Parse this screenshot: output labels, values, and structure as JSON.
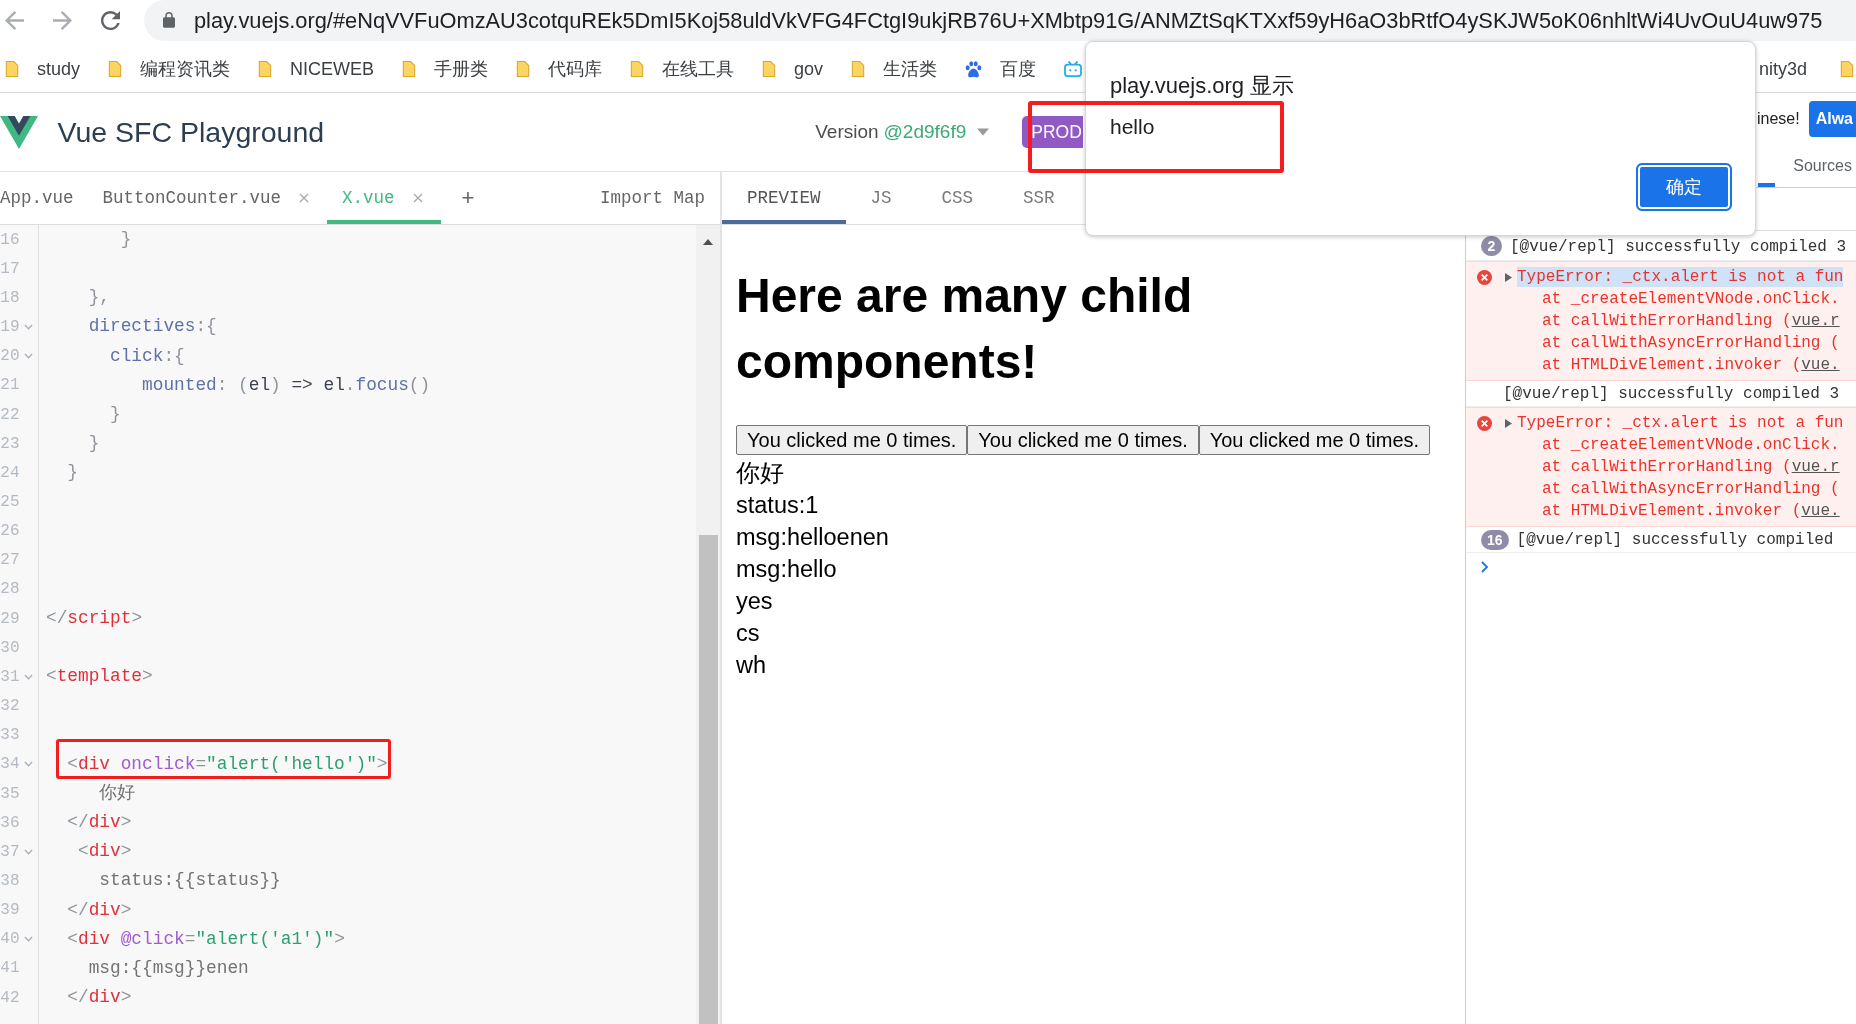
{
  "browser": {
    "nav_buttons": [
      {
        "kind": "back",
        "disabled": true
      },
      {
        "kind": "forward",
        "disabled": true
      },
      {
        "kind": "reload",
        "disabled": false
      }
    ],
    "url": "play.vuejs.org/#eNqVVFuOmzAU3cotquREk5DmI5Koj58uldVkVFG4FCtgI9ukjRB76U+XMbtp91G/ANMZtSqKTXxf59yH6aO3bRtfO4ySKJW5oK06nhltWi4UvOuU4uw975"
  },
  "bookmarks": [
    {
      "kind": "folder",
      "label": "study"
    },
    {
      "kind": "folder",
      "label": "编程资讯类"
    },
    {
      "kind": "folder",
      "label": "NICEWEB"
    },
    {
      "kind": "folder",
      "label": "手册类"
    },
    {
      "kind": "folder",
      "label": "代码库"
    },
    {
      "kind": "folder",
      "label": "在线工具"
    },
    {
      "kind": "folder",
      "label": "gov"
    },
    {
      "kind": "folder",
      "label": "生活类"
    },
    {
      "kind": "paw",
      "label": "百度"
    },
    {
      "kind": "tv"
    }
  ],
  "bookmarks_end": [
    {
      "kind": "text",
      "label": "nity3d"
    },
    {
      "kind": "folder"
    }
  ],
  "dialog": {
    "title": "play.vuejs.org 显示",
    "message": "hello",
    "message_framed": true,
    "buttons": [
      {
        "label": "确定",
        "focused": true
      }
    ]
  },
  "app_header": {
    "title": "Vue SFC Playground",
    "version_label": "Version",
    "version": "@2d9f6f9",
    "mode_badge": "PROD"
  },
  "editor_tabs": [
    {
      "label": "App.vue",
      "selected": false,
      "closable": false
    },
    {
      "label": "ButtonCounter.vue",
      "selected": false,
      "closable": true
    },
    {
      "label": "X.vue",
      "selected": true,
      "closable": true
    }
  ],
  "add_tab": "+",
  "import_map": "Import Map",
  "editor": {
    "lines": [
      {
        "number": "16",
        "foldable": false,
        "framed": false,
        "tokens": [
          {
            "kind": "punct",
            "text": "       }"
          }
        ]
      },
      {
        "number": "17",
        "foldable": false,
        "framed": false
      },
      {
        "number": "18",
        "foldable": false,
        "framed": false,
        "tokens": [
          {
            "kind": "punct",
            "text": "    },"
          }
        ]
      },
      {
        "number": "19",
        "foldable": true,
        "framed": false,
        "tokens": [
          {
            "kind": "prop",
            "text": "    directives"
          },
          {
            "kind": "punct",
            "text": ":{"
          }
        ]
      },
      {
        "number": "20",
        "foldable": true,
        "framed": false,
        "tokens": [
          {
            "kind": "prop",
            "text": "      click"
          },
          {
            "kind": "punct",
            "text": ":{"
          }
        ]
      },
      {
        "number": "21",
        "foldable": false,
        "framed": false,
        "tokens": [
          {
            "kind": "prop",
            "text": "         mounted"
          },
          {
            "kind": "punct",
            "text": ": ("
          },
          {
            "kind": "var",
            "text": "el"
          },
          {
            "kind": "punct",
            "text": ") "
          },
          {
            "kind": "var",
            "text": "=> el"
          },
          {
            "kind": "punct",
            "text": "."
          },
          {
            "kind": "prop",
            "text": "focus"
          },
          {
            "kind": "punct",
            "text": "()"
          }
        ]
      },
      {
        "number": "22",
        "foldable": false,
        "framed": false,
        "tokens": [
          {
            "kind": "punct",
            "text": "      }"
          }
        ]
      },
      {
        "number": "23",
        "foldable": false,
        "framed": false,
        "tokens": [
          {
            "kind": "punct",
            "text": "    }"
          }
        ]
      },
      {
        "number": "24",
        "foldable": false,
        "framed": false,
        "tokens": [
          {
            "kind": "punct",
            "text": "  }"
          }
        ]
      },
      {
        "number": "25",
        "foldable": false,
        "framed": false
      },
      {
        "number": "26",
        "foldable": false,
        "framed": false
      },
      {
        "number": "27",
        "foldable": false,
        "framed": false
      },
      {
        "number": "28",
        "foldable": false,
        "framed": false
      },
      {
        "number": "29",
        "foldable": false,
        "framed": false,
        "tokens": [
          {
            "kind": "punct",
            "text": "</"
          },
          {
            "kind": "tag",
            "text": "script"
          },
          {
            "kind": "punct",
            "text": ">"
          }
        ]
      },
      {
        "number": "30",
        "foldable": false,
        "framed": false
      },
      {
        "number": "31",
        "foldable": true,
        "framed": false,
        "tokens": [
          {
            "kind": "punct",
            "text": "<"
          },
          {
            "kind": "tag",
            "text": "template"
          },
          {
            "kind": "punct",
            "text": ">"
          }
        ]
      },
      {
        "number": "32",
        "foldable": false,
        "framed": false
      },
      {
        "number": "33",
        "foldable": false,
        "framed": false
      },
      {
        "number": "34",
        "foldable": true,
        "framed": true,
        "tokens": [
          {
            "kind": "punct",
            "text": "  <"
          },
          {
            "kind": "tag",
            "text": "div "
          },
          {
            "kind": "attr",
            "text": "onclick"
          },
          {
            "kind": "punct",
            "text": "="
          },
          {
            "kind": "string",
            "text": "\"alert('hello')\""
          },
          {
            "kind": "punct",
            "text": ">"
          }
        ]
      },
      {
        "number": "35",
        "foldable": false,
        "framed": false,
        "tokens": [
          {
            "kind": "text",
            "text": "     你好"
          }
        ]
      },
      {
        "number": "36",
        "foldable": false,
        "framed": false,
        "tokens": [
          {
            "kind": "punct",
            "text": "  </"
          },
          {
            "kind": "tag",
            "text": "div"
          },
          {
            "kind": "punct",
            "text": ">"
          }
        ]
      },
      {
        "number": "37",
        "foldable": true,
        "framed": false,
        "tokens": [
          {
            "kind": "punct",
            "text": "   <"
          },
          {
            "kind": "tag",
            "text": "div"
          },
          {
            "kind": "punct",
            "text": ">"
          }
        ]
      },
      {
        "number": "38",
        "foldable": false,
        "framed": false,
        "tokens": [
          {
            "kind": "text",
            "text": "     status:{{status}}"
          }
        ]
      },
      {
        "number": "39",
        "foldable": false,
        "framed": false,
        "tokens": [
          {
            "kind": "punct",
            "text": "  </"
          },
          {
            "kind": "tag",
            "text": "div"
          },
          {
            "kind": "punct",
            "text": ">"
          }
        ]
      },
      {
        "number": "40",
        "foldable": true,
        "framed": false,
        "tokens": [
          {
            "kind": "punct",
            "text": "  <"
          },
          {
            "kind": "tag",
            "text": "div "
          },
          {
            "kind": "attr",
            "text": "@click"
          },
          {
            "kind": "punct",
            "text": "="
          },
          {
            "kind": "string",
            "text": "\"alert('a1')\""
          },
          {
            "kind": "punct",
            "text": ">"
          }
        ]
      },
      {
        "number": "41",
        "foldable": false,
        "framed": false,
        "tokens": [
          {
            "kind": "text",
            "text": "    msg:{{msg}}enen"
          }
        ]
      },
      {
        "number": "42",
        "foldable": false,
        "framed": false,
        "tokens": [
          {
            "kind": "punct",
            "text": "  </"
          },
          {
            "kind": "tag",
            "text": "div"
          },
          {
            "kind": "punct",
            "text": ">"
          }
        ]
      }
    ]
  },
  "preview_tabs": [
    {
      "label": "PREVIEW",
      "selected": true
    },
    {
      "label": "JS",
      "selected": false
    },
    {
      "label": "CSS",
      "selected": false
    },
    {
      "label": "SSR",
      "selected": false
    }
  ],
  "preview": {
    "heading": "Here are many child components!",
    "buttons": [
      "You clicked me 0 times.",
      "You clicked me 0 times.",
      "You clicked me 0 times."
    ],
    "lines": [
      "你好",
      "status:1",
      "msg:helloenen",
      "msg:hello",
      "yes",
      "cs",
      "wh"
    ]
  },
  "devtools": {
    "banner_text": "inese!",
    "banner_button": "Alwa",
    "tabs": [
      {
        "selected": true
      },
      {
        "label": "Sources",
        "selected": false
      }
    ],
    "console": [
      {
        "kind": "log",
        "count": "2",
        "text": "[@vue/repl] successfully compiled 3"
      },
      {
        "kind": "error",
        "expanded": false,
        "highlighted": true,
        "message": "TypeError: _ctx.alert is not a fun",
        "stack": [
          {
            "text": "at _createElementVNode.onClick."
          },
          {
            "text": "at callWithErrorHandling (",
            "link": "vue.r"
          },
          {
            "text": "at callWithAsyncErrorHandling ("
          },
          {
            "text": "at HTMLDivElement.invoker (",
            "link": "vue."
          }
        ]
      },
      {
        "kind": "log",
        "text": "[@vue/repl] successfully compiled 3"
      },
      {
        "kind": "error",
        "expanded": false,
        "highlighted": false,
        "message": "TypeError: _ctx.alert is not a fun",
        "stack": [
          {
            "text": "at _createElementVNode.onClick."
          },
          {
            "text": "at callWithErrorHandling (",
            "link": "vue.r"
          },
          {
            "text": "at callWithAsyncErrorHandling ("
          },
          {
            "text": "at HTMLDivElement.invoker (",
            "link": "vue."
          }
        ]
      },
      {
        "kind": "log",
        "count": "16",
        "text": "[@vue/repl] successfully compiled"
      },
      {
        "kind": "prompt"
      }
    ]
  }
}
